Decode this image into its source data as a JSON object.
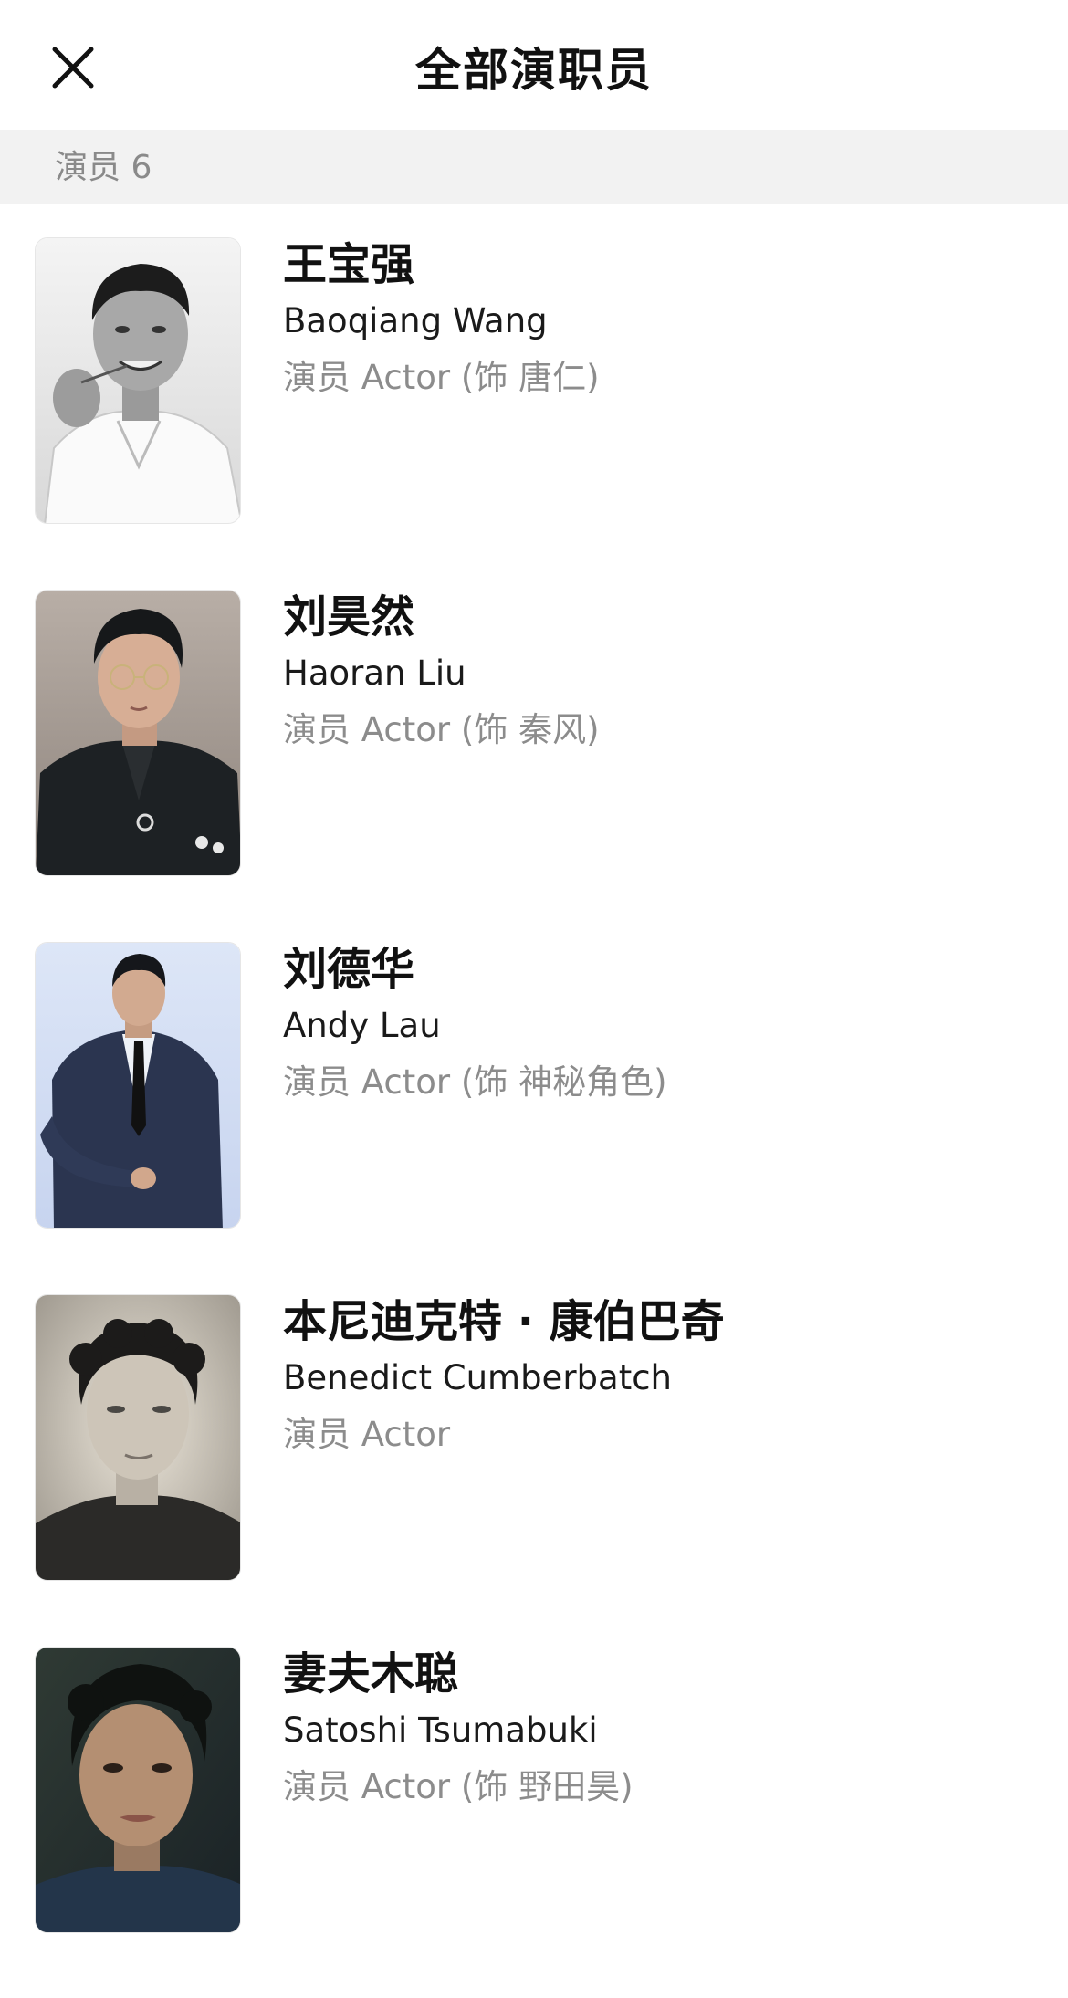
{
  "header": {
    "title": "全部演职员",
    "close_icon": "close-icon"
  },
  "section": {
    "label": "演员 6"
  },
  "cast": [
    {
      "name_cn": "王宝强",
      "name_en": "Baoqiang Wang",
      "role": "演员 Actor (饰 唐仁)",
      "photo_style": "bw-portrait"
    },
    {
      "name_cn": "刘昊然",
      "name_en": "Haoran Liu",
      "role": "演员 Actor (饰 秦风)",
      "photo_style": "dark-suit-portrait"
    },
    {
      "name_cn": "刘德华",
      "name_en": "Andy Lau",
      "role": "演员 Actor (饰 神秘角色)",
      "photo_style": "navy-suit-full"
    },
    {
      "name_cn": "本尼迪克特 · 康伯巴奇",
      "name_en": "Benedict Cumberbatch",
      "role": "演员 Actor",
      "photo_style": "sepia-portrait"
    },
    {
      "name_cn": "妻夫木聪",
      "name_en": "Satoshi Tsumabuki",
      "role": "演员 Actor (饰 野田昊)",
      "photo_style": "dark-teal-portrait"
    }
  ]
}
